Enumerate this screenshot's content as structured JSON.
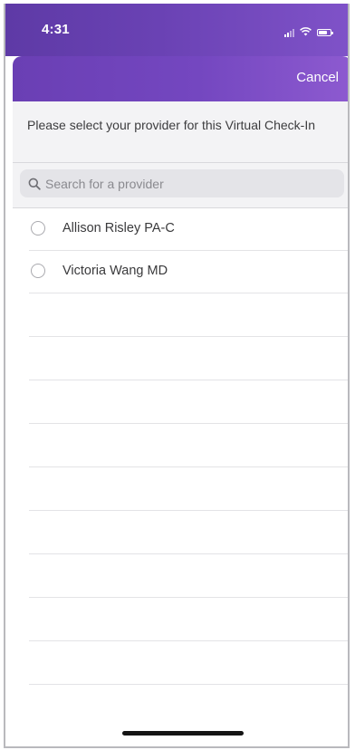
{
  "status_bar": {
    "time": "4:31"
  },
  "nav": {
    "cancel_label": "Cancel"
  },
  "prompt": {
    "text": "Please select your provider for this Virtual Check-In"
  },
  "search": {
    "placeholder": "Search for a provider",
    "value": ""
  },
  "providers": [
    {
      "name": "Allison Risley PA-C",
      "selected": false
    },
    {
      "name": "Victoria Wang MD",
      "selected": false
    }
  ],
  "colors": {
    "header_gradient_start": "#5e3aa6",
    "header_gradient_end": "#8d5ad0",
    "background": "#ffffff"
  },
  "icons": {
    "search": "magnifier",
    "radio": "empty-circle",
    "signal": "cellular-bars",
    "wifi": "wifi",
    "battery": "battery"
  }
}
